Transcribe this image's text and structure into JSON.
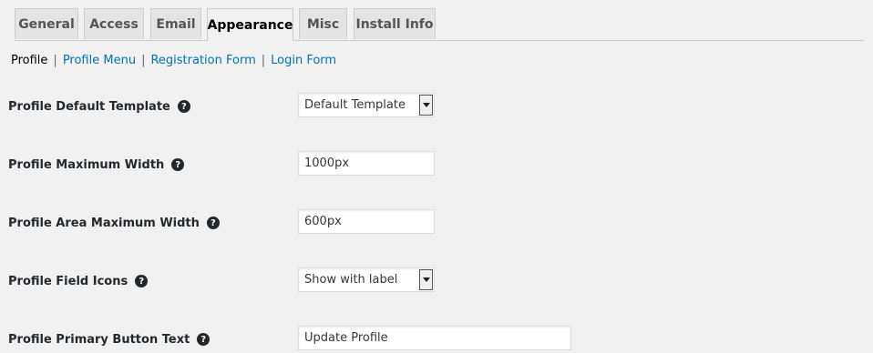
{
  "tabs": [
    {
      "label": "General"
    },
    {
      "label": "Access"
    },
    {
      "label": "Email"
    },
    {
      "label": "Appearance",
      "active": true
    },
    {
      "label": "Misc"
    },
    {
      "label": "Install Info"
    }
  ],
  "subnav": {
    "current": "Profile",
    "links": [
      "Profile Menu",
      "Registration Form",
      "Login Form"
    ],
    "separator": "|"
  },
  "settings": [
    {
      "label": "Profile Default Template",
      "type": "select",
      "value": "Default Template",
      "help_icon": "question-circle-icon"
    },
    {
      "label": "Profile Maximum Width",
      "type": "text",
      "value": "1000px",
      "help_icon": "question-circle-icon"
    },
    {
      "label": "Profile Area Maximum Width",
      "type": "text",
      "value": "600px",
      "help_icon": "question-circle-icon"
    },
    {
      "label": "Profile Field Icons",
      "type": "select",
      "value": "Show with label",
      "help_icon": "question-circle-icon"
    },
    {
      "label": "Profile Primary Button Text",
      "type": "text",
      "value": "Update Profile",
      "help_icon": "question-circle-icon"
    }
  ],
  "help_glyph": "?",
  "colors": {
    "background": "#f1f1f1",
    "tab_inactive": "#e4e4e4",
    "link": "#0073aa",
    "text": "#23282d"
  }
}
